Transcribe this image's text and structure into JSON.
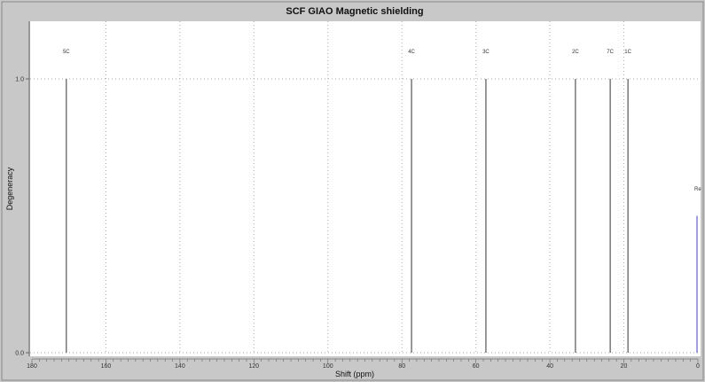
{
  "chart_data": {
    "type": "bar",
    "title": "SCF GIAO Magnetic shielding",
    "xlabel": "Shift (ppm)",
    "ylabel": "Degeneracy",
    "xlim": [
      180,
      0
    ],
    "ylim": [
      0,
      1.2
    ],
    "x_ticks": [
      "180",
      "160",
      "140",
      "120",
      "100",
      "80",
      "60",
      "40",
      "20",
      "0"
    ],
    "y_ticks": [
      "1.0",
      "0.0"
    ],
    "grid": true,
    "peaks": [
      {
        "label": "5C",
        "x": 170.7,
        "y": 1.0
      },
      {
        "label": "4C",
        "x": 77.4,
        "y": 1.0
      },
      {
        "label": "3C",
        "x": 57.3,
        "y": 1.0
      },
      {
        "label": "2C",
        "x": 33.1,
        "y": 1.0
      },
      {
        "label": "7C",
        "x": 23.7,
        "y": 1.0
      },
      {
        "label": "1C",
        "x": 18.9,
        "y": 1.0
      }
    ],
    "reference": {
      "label": "Re",
      "x": 0,
      "y": 0.5,
      "color": "#8080d0"
    },
    "peak_color": "#555555",
    "grid_color": "#ffff99"
  }
}
